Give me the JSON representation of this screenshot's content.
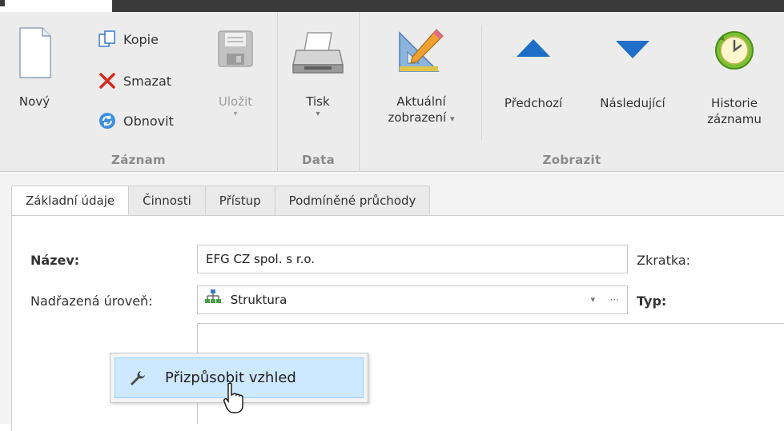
{
  "ribbon": {
    "groups": {
      "zaznam": "Záznam",
      "data": "Data",
      "zobrazit": "Zobrazit"
    },
    "buttons": {
      "novy": "Nový",
      "kopie": "Kopie",
      "smazat": "Smazat",
      "obnovit": "Obnovit",
      "ulozit": "Uložit",
      "tisk": "Tisk",
      "aktualni_line1": "Aktuální",
      "aktualni_line2": "zobrazení",
      "predchozi": "Předchozí",
      "nasledujici": "Následující",
      "historie_line1": "Historie",
      "historie_line2": "záznamu"
    }
  },
  "tabs": [
    "Základní údaje",
    "Činnosti",
    "Přístup",
    "Podmíněné průchody"
  ],
  "form": {
    "nazev_label": "Název:",
    "nazev_value": "EFG CZ spol. s r.o.",
    "zkratka_label": "Zkratka:",
    "nadrazena_label": "Nadřazená úroveň:",
    "nadrazena_value": "Struktura",
    "typ_label": "Typ:",
    "ellipsis": "···",
    "dropdown_caret": "▾"
  },
  "context_menu": {
    "item": "Přizpůsobit vzhled"
  },
  "colors": {
    "ribbon_bg": "#ececec",
    "nav_arrow": "#1e6fc8",
    "menu_highlight": "#cde8ff"
  }
}
